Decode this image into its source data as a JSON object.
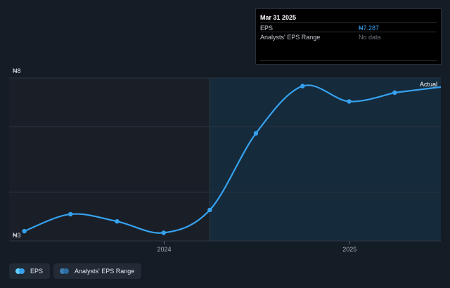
{
  "colors": {
    "background": "#141c26",
    "past_band": "#1a1f27",
    "forecast_band": "#152a3b",
    "line": "#36a2ef",
    "grid": "#2c3440",
    "range_icon": "#2b6d9e"
  },
  "tooltip": {
    "date": "Mar 31 2025",
    "eps_label": "EPS",
    "eps_value": "₦7.287",
    "range_label": "Analysts' EPS Range",
    "range_value": "No data"
  },
  "legend": {
    "eps_label": "EPS",
    "range_label": "Analysts' EPS Range"
  },
  "chart_data": {
    "type": "line",
    "title": "",
    "xlabel": "",
    "ylabel": "",
    "y_top_label": "₦8",
    "y_bottom_label": "₦3",
    "ylim": [
      3,
      8
    ],
    "xlim": [
      "2023-03-01",
      "2025-06-30"
    ],
    "x_ticks": [
      {
        "date": "2024-01-01",
        "label": "2024"
      },
      {
        "date": "2025-01-01",
        "label": "2025"
      }
    ],
    "forecast_start": "2024-03-31",
    "annotation": "Actual",
    "series": [
      {
        "name": "EPS",
        "x": [
          "2023-03-31",
          "2023-06-30",
          "2023-09-30",
          "2023-12-31",
          "2024-03-31",
          "2024-06-30",
          "2024-09-30",
          "2024-12-31",
          "2025-03-31"
        ],
        "values": [
          3.3,
          3.82,
          3.6,
          3.25,
          3.95,
          6.3,
          7.75,
          7.28,
          7.55
        ]
      }
    ]
  }
}
